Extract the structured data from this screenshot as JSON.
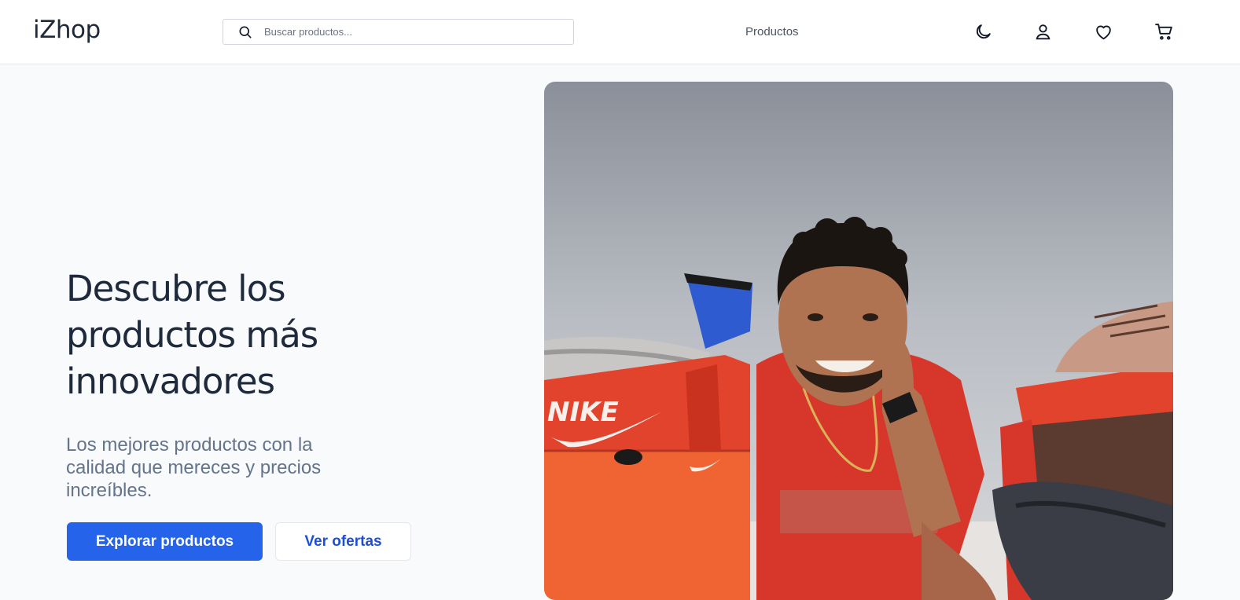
{
  "header": {
    "logo": "iZhop",
    "search_placeholder": "Buscar productos...",
    "nav_link": "Productos",
    "icons": [
      "moon-icon",
      "user-icon",
      "heart-icon",
      "cart-icon"
    ]
  },
  "hero": {
    "title": "Descubre los productos más innovadores",
    "subtitle": "Los mejores productos con la calidad que mereces y precios increíbles.",
    "primary_cta": "Explorar productos",
    "secondary_cta": "Ver ofertas",
    "image_box_text": "NIKE"
  },
  "colors": {
    "accent": "#2563eb",
    "heading": "#1e293b",
    "muted": "#64748b"
  }
}
